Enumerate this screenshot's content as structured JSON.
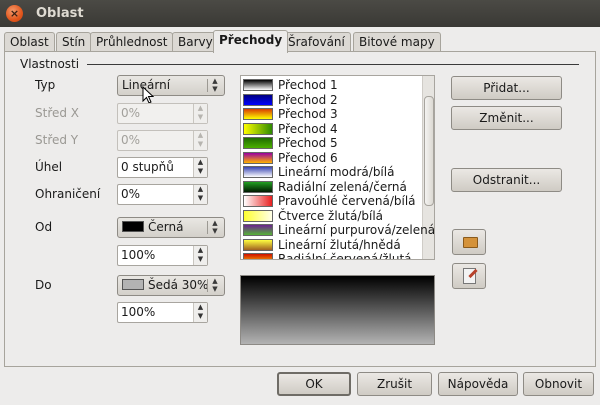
{
  "window": {
    "title": "Oblast",
    "close_glyph": "×"
  },
  "tabs": [
    "Oblast",
    "Stín",
    "Průhlednost",
    "Barvy",
    "Přechody",
    "Šrafování",
    "Bitové mapy"
  ],
  "active_tab": "Přechody",
  "group": {
    "title": "Vlastnosti"
  },
  "fields": {
    "typ": {
      "label": "Typ",
      "value": "Lineární"
    },
    "stred_x": {
      "label": "Střed X",
      "value": "0%"
    },
    "stred_y": {
      "label": "Střed Y",
      "value": "0%"
    },
    "uhel": {
      "label": "Úhel",
      "value": "0 stupňů"
    },
    "ohraniceni": {
      "label": "Ohraničení",
      "value": "0%"
    },
    "od": {
      "label": "Od",
      "color_name": "Černá",
      "color": "#000000",
      "intensity": "100%"
    },
    "do": {
      "label": "Do",
      "color_name": "Šedá 30%",
      "color": "#b3b3b3",
      "intensity": "100%"
    }
  },
  "gradients": [
    {
      "name": "Přechod 1",
      "c1": "#000000",
      "c2": "#ffffff",
      "dir": "to bottom"
    },
    {
      "name": "Přechod 2",
      "c1": "#000080",
      "c2": "#0000ff",
      "dir": "to bottom"
    },
    {
      "name": "Přechod 3",
      "c1": "#d93b00",
      "c2": "#ffff00",
      "dir": "to bottom"
    },
    {
      "name": "Přechod 4",
      "c1": "#ffff00",
      "c2": "#2e8b00",
      "dir": "to right"
    },
    {
      "name": "Přechod 5",
      "c1": "#1f6b00",
      "c2": "#4bb000",
      "dir": "to bottom"
    },
    {
      "name": "Přechod 6",
      "c1": "#9a00a0",
      "c2": "#ffb400",
      "dir": "to bottom"
    },
    {
      "name": "Lineární modrá/bílá",
      "c1": "#3846b3",
      "c2": "#ffffff",
      "dir": "to bottom"
    },
    {
      "name": "Radiální zelená/černá",
      "c1": "#22a022",
      "c2": "#001800",
      "dir": "to bottom"
    },
    {
      "name": "Pravoúhlé červená/bílá",
      "c1": "#ffffff",
      "c2": "#e82020",
      "dir": "to right"
    },
    {
      "name": "Čtverce žlutá/bílá",
      "c1": "#ffff30",
      "c2": "#ffffe8",
      "dir": "to right"
    },
    {
      "name": "Lineární purpurová/zelená",
      "c1": "#6b2390",
      "c2": "#56b436",
      "dir": "to bottom"
    },
    {
      "name": "Lineární žlutá/hnědá",
      "c1": "#ffff40",
      "c2": "#a06020",
      "dir": "to bottom"
    },
    {
      "name": "Radiální červená/žlutá",
      "c1": "#d01000",
      "c2": "#ffd000",
      "dir": "to bottom"
    }
  ],
  "preview": {
    "from": "#000000",
    "to": "#b3b3b3"
  },
  "side_buttons": {
    "add": "Přidat...",
    "change": "Změnit...",
    "remove": "Odstranit..."
  },
  "icons": {
    "open": "folder-open-icon",
    "save": "save-list-icon"
  },
  "footer": {
    "ok": "OK",
    "cancel": "Zrušit",
    "help": "Nápověda",
    "reset": "Obnovit"
  }
}
